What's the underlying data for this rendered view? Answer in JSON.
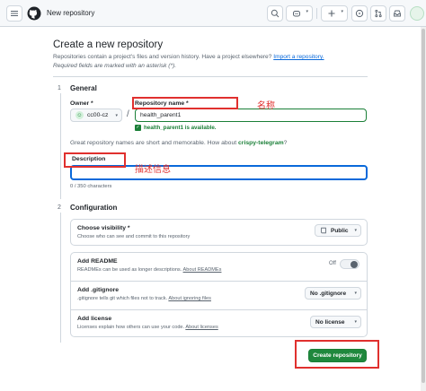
{
  "header": {
    "breadcrumb": "New repository",
    "icons": [
      "menu-icon",
      "github-logo-icon",
      "search-icon",
      "copilot-icon",
      "plus-icon",
      "issues-icon",
      "pull-requests-icon",
      "inbox-icon",
      "avatar"
    ]
  },
  "page": {
    "title": "Create a new repository",
    "subtitle": "Repositories contain a project's files and version history. Have a project elsewhere?",
    "import_link": "Import a repository.",
    "required_note": "Required fields are marked with an asterisk (*)."
  },
  "general": {
    "step": "1",
    "heading": "General",
    "owner_label": "Owner *",
    "owner_value": "cc00-cz",
    "slash": "/",
    "repo_label": "Repository name *",
    "repo_value": "health_parent1",
    "available": "health_parent1 is available.",
    "suggestion_prefix": "Great repository names are short and memorable. How about",
    "suggestion_name": "crispy-telegram",
    "suggestion_suffix": "?",
    "description_label": "Description",
    "description_value": "",
    "char_count": "0 / 350 characters"
  },
  "annotations": {
    "name_note": "名称",
    "desc_note": "描述信息"
  },
  "configuration": {
    "step": "2",
    "heading": "Configuration",
    "visibility": {
      "title": "Choose visibility *",
      "desc": "Choose who can see and commit to this repository",
      "value": "Public"
    },
    "readme": {
      "title": "Add README",
      "desc": "READMEs can be used as longer descriptions.",
      "link": "About READMEs",
      "toggle_state": "Off"
    },
    "gitignore": {
      "title": "Add .gitignore",
      "desc": ".gitignore tells git which files not to track.",
      "link": "About ignoring files",
      "value": "No .gitignore"
    },
    "license": {
      "title": "Add license",
      "desc": "Licenses explain how others can use your code.",
      "link": "About licenses",
      "value": "No license"
    }
  },
  "actions": {
    "create_label": "Create repository"
  },
  "colors": {
    "accent_green": "#1f883d",
    "link_blue": "#0969da",
    "annotation_red": "#e0302e"
  }
}
